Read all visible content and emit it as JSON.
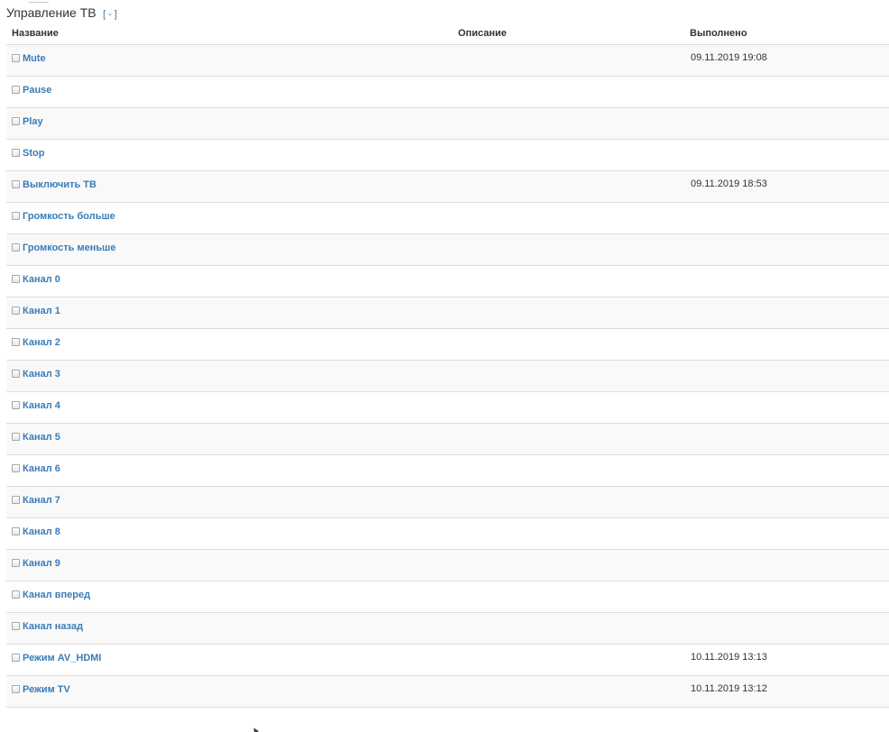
{
  "section": {
    "title": "Управление ТВ",
    "toggle_label": "[ - ]"
  },
  "table": {
    "headers": {
      "name": "Название",
      "description": "Описание",
      "executed": "Выполнено"
    },
    "rows": [
      {
        "name": "Mute",
        "description": "",
        "executed": "09.11.2019 19:08"
      },
      {
        "name": "Pause",
        "description": "",
        "executed": ""
      },
      {
        "name": "Play",
        "description": "",
        "executed": ""
      },
      {
        "name": "Stop",
        "description": "",
        "executed": ""
      },
      {
        "name": "Выключить ТВ",
        "description": "",
        "executed": "09.11.2019 18:53"
      },
      {
        "name": "Громкость больше",
        "description": "",
        "executed": ""
      },
      {
        "name": "Громкость меньше",
        "description": "",
        "executed": ""
      },
      {
        "name": "Канал 0",
        "description": "",
        "executed": ""
      },
      {
        "name": "Канал 1",
        "description": "",
        "executed": ""
      },
      {
        "name": "Канал 2",
        "description": "",
        "executed": ""
      },
      {
        "name": "Канал 3",
        "description": "",
        "executed": ""
      },
      {
        "name": "Канал 4",
        "description": "",
        "executed": ""
      },
      {
        "name": "Канал 5",
        "description": "",
        "executed": ""
      },
      {
        "name": "Канал 6",
        "description": "",
        "executed": ""
      },
      {
        "name": "Канал 7",
        "description": "",
        "executed": ""
      },
      {
        "name": "Канал 8",
        "description": "",
        "executed": ""
      },
      {
        "name": "Канал 9",
        "description": "",
        "executed": ""
      },
      {
        "name": "Канал вперед",
        "description": "",
        "executed": ""
      },
      {
        "name": "Канал назад",
        "description": "",
        "executed": ""
      },
      {
        "name": "Режим AV_HDMI",
        "description": "",
        "executed": "10.11.2019 13:13"
      },
      {
        "name": "Режим TV",
        "description": "",
        "executed": "10.11.2019 13:12"
      }
    ]
  },
  "icons": {
    "row_checkbox": "checkbox-icon",
    "cursor": "mouse-cursor-icon"
  },
  "colors": {
    "link": "#3a7cb9",
    "text": "#333333",
    "row_stripe": "#f9f9f9",
    "border": "#dddddd"
  }
}
